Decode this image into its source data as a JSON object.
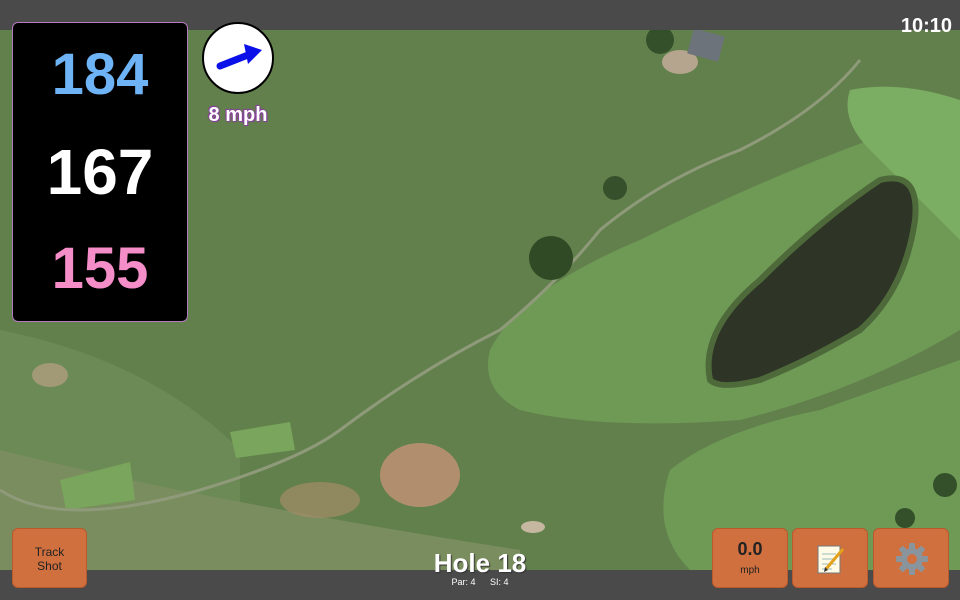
{
  "status_bar": {
    "time": "10:10"
  },
  "distances": {
    "back": "184",
    "middle": "167",
    "front": "155"
  },
  "wind": {
    "speed": "8 mph",
    "direction_icon": "arrow-icon"
  },
  "hole": {
    "title": "Hole 18",
    "par": "Par: 4",
    "si": "SI: 4"
  },
  "buttons": {
    "track_shot_line1": "Track",
    "track_shot_line2": "Shot",
    "speed_value": "0.0",
    "speed_unit": "mph",
    "notes_icon": "notepad-icon",
    "settings_icon": "gear-icon"
  },
  "colors": {
    "back_distance": "#6eb3f5",
    "middle_distance": "#ffffff",
    "front_distance": "#f48dc8",
    "button": "#d0703f",
    "panel": "#000000"
  }
}
